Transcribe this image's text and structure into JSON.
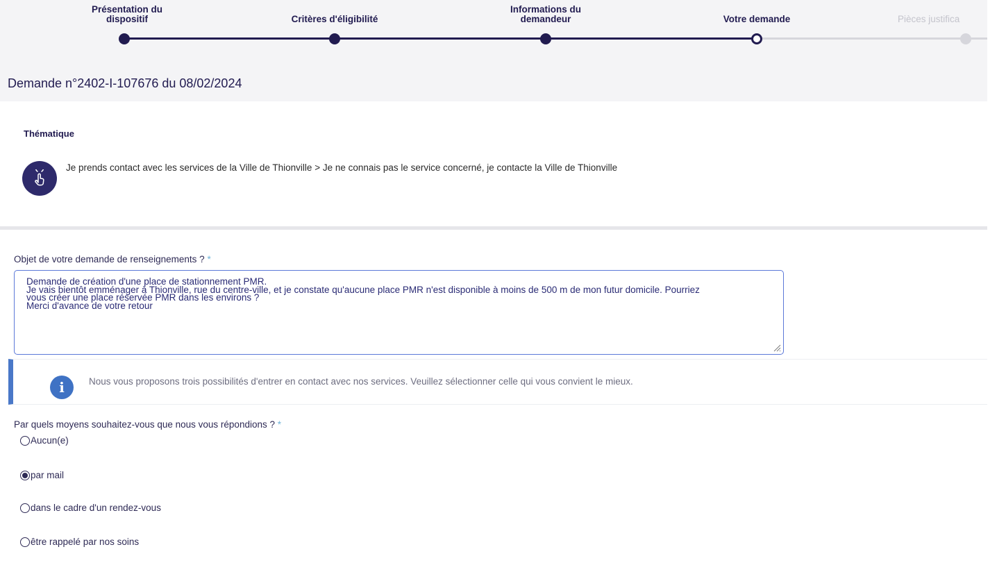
{
  "stepper": {
    "steps": [
      {
        "label": "Présentation du\ndispositif",
        "state": "done"
      },
      {
        "label": "Critères d'éligibilité",
        "state": "done"
      },
      {
        "label": "Informations du\ndemandeur",
        "state": "done"
      },
      {
        "label": "Votre demande",
        "state": "current"
      },
      {
        "label": "Pièces justifica",
        "state": "future"
      }
    ]
  },
  "header": {
    "title": "Demande n°2402-I-107676 du 08/02/2024"
  },
  "thematique": {
    "label": "Thématique",
    "icon": "touch-hand-icon",
    "text": "Je prends contact avec les services de la Ville de Thionville > Je ne connais pas le service concerné, je contacte la Ville de Thionville"
  },
  "objet": {
    "label": "Objet de votre demande de renseignements ?",
    "required_mark": "*",
    "value": "Demande de création d'une place de stationnement PMR.\nJe vais bientôt emménager à Thionville, rue du centre-ville, et je constate qu'aucune place PMR n'est disponible à moins de 500 m de mon futur domicile. Pourriez\nvous créer une place réservée PMR dans les environs ?\nMerci d'avance de votre retour"
  },
  "info": {
    "icon": "info-icon",
    "glyph": "i",
    "text": "Nous vous proposons trois possibilités d'entrer en contact avec nos services. Veuillez sélectionner celle qui vous convient le mieux."
  },
  "reponse": {
    "label": "Par quels moyens souhaitez-vous que nous vous répondions ?",
    "required_mark": "*",
    "options": [
      {
        "label": "Aucun(e)",
        "selected": false
      },
      {
        "label": "par mail",
        "selected": true
      },
      {
        "label": "dans le cadre d'un rendez-vous",
        "selected": false
      },
      {
        "label": "être rappelé par nos soins",
        "selected": false
      }
    ]
  },
  "colors": {
    "primary": "#211b50",
    "accent_blue": "#4a78c8",
    "required": "#6fb3d8",
    "inactive": "#d6d6dc"
  }
}
